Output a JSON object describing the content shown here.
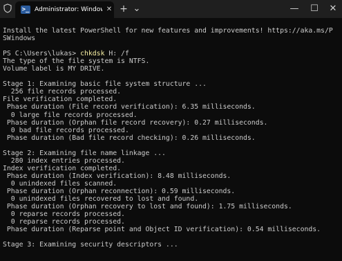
{
  "window": {
    "tab_title": "Administrator: Windows PowerShell",
    "tab_icon_glyph": ">_",
    "new_tab_glyph": "+",
    "dropdown_glyph": "⌄",
    "minimize_glyph": "—",
    "maximize_glyph": "☐",
    "close_glyph": "✕",
    "tab_close_glyph": "✕"
  },
  "terminal": {
    "intro_1": "Install the latest PowerShell for new features and improvements! https://aka.ms/P",
    "intro_2": "SWindows",
    "prompt": "PS C:\\Users\\lukas> ",
    "command": "chkdsk",
    "args": " H: /f",
    "lines": [
      "The type of the file system is NTFS.",
      "Volume label is MY DRIVE.",
      "",
      "Stage 1: Examining basic file system structure ...",
      "  256 file records processed.",
      "File verification completed.",
      " Phase duration (File record verification): 6.35 milliseconds.",
      "  0 large file records processed.",
      " Phase duration (Orphan file record recovery): 0.27 milliseconds.",
      "  0 bad file records processed.",
      " Phase duration (Bad file record checking): 0.26 milliseconds.",
      "",
      "Stage 2: Examining file name linkage ...",
      "  280 index entries processed.",
      "Index verification completed.",
      " Phase duration (Index verification): 8.48 milliseconds.",
      "  0 unindexed files scanned.",
      " Phase duration (Orphan reconnection): 0.59 milliseconds.",
      "  0 unindexed files recovered to lost and found.",
      " Phase duration (Orphan recovery to lost and found): 1.75 milliseconds.",
      "  0 reparse records processed.",
      "  0 reparse records processed.",
      " Phase duration (Reparse point and Object ID verification): 0.54 milliseconds.",
      "",
      "Stage 3: Examining security descriptors ..."
    ]
  },
  "colors": {
    "background": "#0c0c0c",
    "titlebar": "#1f1f1f",
    "text": "#cccccc",
    "command": "#f9f1a5"
  }
}
